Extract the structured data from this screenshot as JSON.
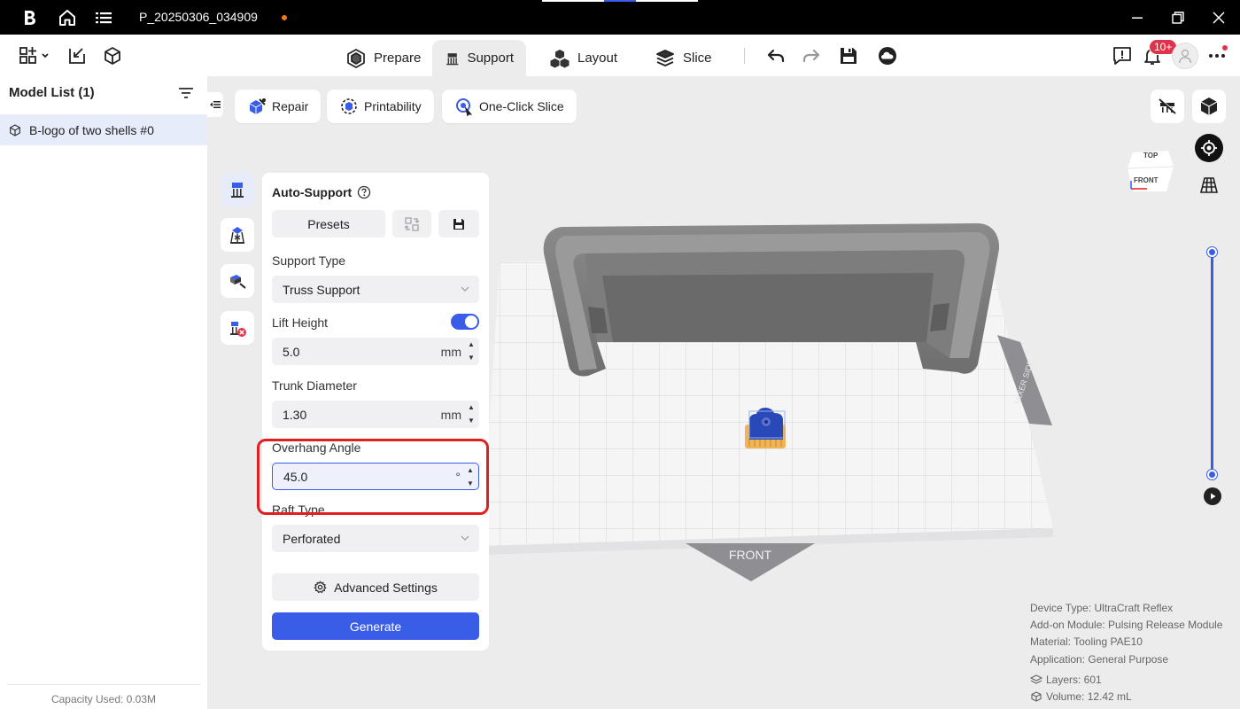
{
  "titlebar": {
    "filename": "P_20250306_034909"
  },
  "modes": {
    "prepare": "Prepare",
    "support": "Support",
    "layout": "Layout",
    "slice": "Slice"
  },
  "notifications": {
    "badge": "10+"
  },
  "model_list": {
    "title": "Model List (1)",
    "items": [
      {
        "label": "B-logo of two shells #0"
      }
    ],
    "capacity": "Capacity Used: 0.03M"
  },
  "actions": {
    "repair": "Repair",
    "printability": "Printability",
    "one_click_slice": "One-Click Slice"
  },
  "auto_support": {
    "title": "Auto-Support",
    "presets": "Presets",
    "support_type": {
      "label": "Support Type",
      "value": "Truss Support"
    },
    "lift_height": {
      "label": "Lift Height",
      "enabled": true,
      "value": "5.0",
      "unit": "mm"
    },
    "trunk_diameter": {
      "label": "Trunk Diameter",
      "value": "1.30",
      "unit": "mm"
    },
    "overhang_angle": {
      "label": "Overhang Angle",
      "value": "45.0",
      "unit": "°"
    },
    "raft_type": {
      "label": "Raft Type",
      "value": "Perforated"
    },
    "advanced_settings": "Advanced Settings",
    "generate": "Generate"
  },
  "scene": {
    "front_label": "FRONT",
    "side_label": "MIXER SIDE",
    "viewcube_top": "TOP",
    "viewcube_front": "FRONT"
  },
  "device_info": {
    "device_type": "Device Type:  UltraCraft Reflex",
    "addon_module": "Add-on Module:  Pulsing Release Module",
    "material": "Material:  Tooling PAE10",
    "application": "Application:  General Purpose",
    "layers": "Layers: 601",
    "volume": "Volume: 12.42 mL"
  },
  "colors": {
    "accent": "#3a5de8",
    "highlight": "#e02020",
    "badge": "#e0334b"
  }
}
